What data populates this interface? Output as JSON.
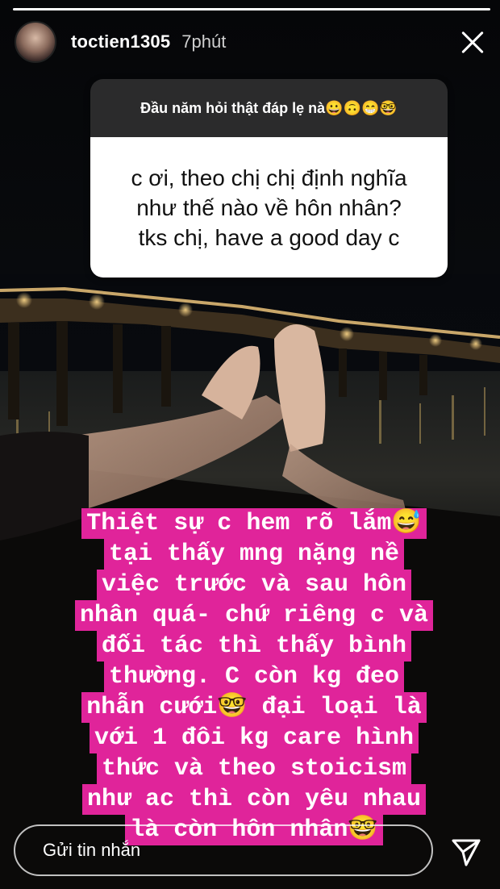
{
  "story": {
    "progress_fraction": 1.0,
    "username": "toctien1305",
    "time": "7phút"
  },
  "icons": {
    "avatar": "profile-photo",
    "close": "close-icon",
    "send": "paper-plane-icon"
  },
  "question": {
    "prompt": "Đầu năm hỏi thật đáp lẹ nà😀🙃😁🤓",
    "lines": [
      "c ơi, theo chị chị định nghĩa",
      "như thế nào về hôn nhân?",
      "tks chị, have a good day c"
    ]
  },
  "answer": {
    "highlight_color": "#e0249a",
    "lines": [
      "Thiệt sự c hem rõ lắm😅",
      "tại thấy mng nặng nề",
      "việc trước và sau hôn",
      "nhân quá- chứ riêng c và",
      "đối tác thì thấy bình",
      "thường. C còn kg đeo",
      "nhẫn cưới🤓 đại loại là",
      "với 1 đôi kg care hình",
      "thức và theo stoicism",
      "như ac thì còn yêu nhau",
      "là còn hôn nhân🤓"
    ]
  },
  "reply": {
    "placeholder": "Gửi tin nhắn"
  }
}
